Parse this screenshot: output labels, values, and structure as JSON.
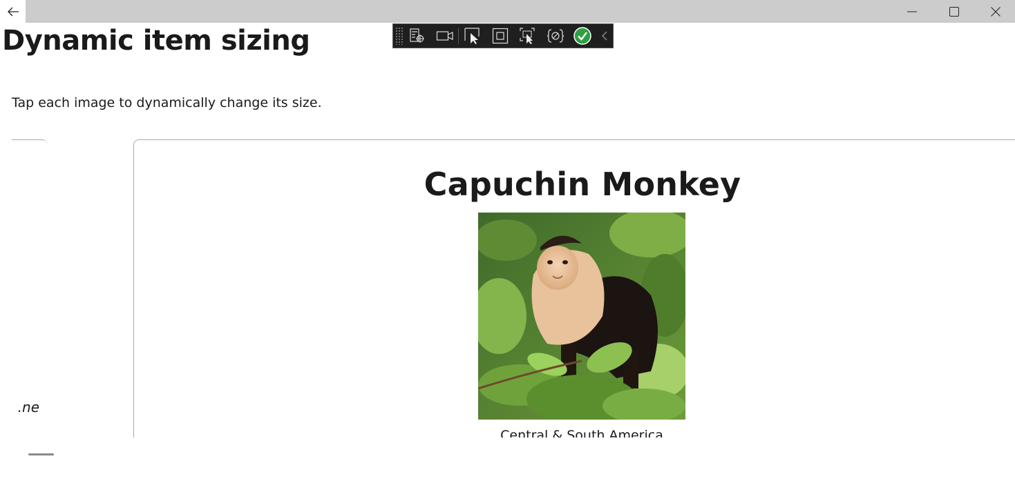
{
  "window": {
    "back_icon": "back-arrow-icon",
    "minimize_icon": "minimize-icon",
    "maximize_icon": "maximize-icon",
    "close_icon": "close-icon"
  },
  "debug_toolbar": {
    "tools": [
      "live-visual-tree-icon",
      "record-icon",
      "select-element-icon",
      "display-layout-adorners-icon",
      "track-focus-icon",
      "binding-failures-icon",
      "accessibility-check-icon",
      "collapse-chevron-icon"
    ],
    "accent_color": "#2ea043"
  },
  "page": {
    "title": "Dynamic item sizing",
    "instructions": "Tap each image to dynamically change its size."
  },
  "carousel": {
    "prev_card_text": "ne.",
    "current_card": {
      "title": "Capuchin Monkey",
      "image_icon": "capuchin-monkey-photo",
      "subtitle": "Central & South America"
    }
  }
}
